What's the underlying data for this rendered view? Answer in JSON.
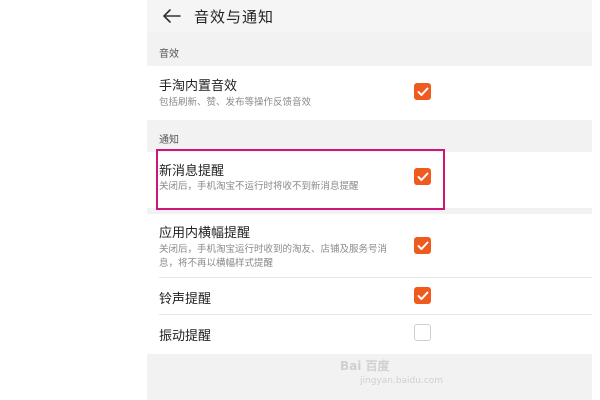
{
  "header": {
    "title": "音效与通知"
  },
  "sections": {
    "sound": {
      "label": "音效",
      "items": [
        {
          "title": "手淘内置音效",
          "desc": "包括刷新、赞、发布等操作反馈音效",
          "checked": true
        }
      ]
    },
    "notify": {
      "label": "通知",
      "items": [
        {
          "title": "新消息提醒",
          "desc": "关闭后，手机淘宝不运行时将收不到新消息提醒",
          "checked": true
        },
        {
          "title": "应用内横幅提醒",
          "desc1": "关闭后，手机淘宝运行时收到的淘友、店铺及服务号消",
          "desc2": "息，将不再以横幅样式提醒",
          "checked": true
        },
        {
          "title": "铃声提醒",
          "checked": true
        },
        {
          "title": "振动提醒",
          "checked": false
        }
      ]
    }
  },
  "watermark": {
    "text": "Bai 百度",
    "sub": "jingyan.baidu.com"
  },
  "colors": {
    "accent": "#ef5a1e",
    "highlight": "#d0157a",
    "background": "#f2f2f2"
  },
  "icons": {
    "back": "arrow-left-icon",
    "check": "checkmark-icon"
  }
}
